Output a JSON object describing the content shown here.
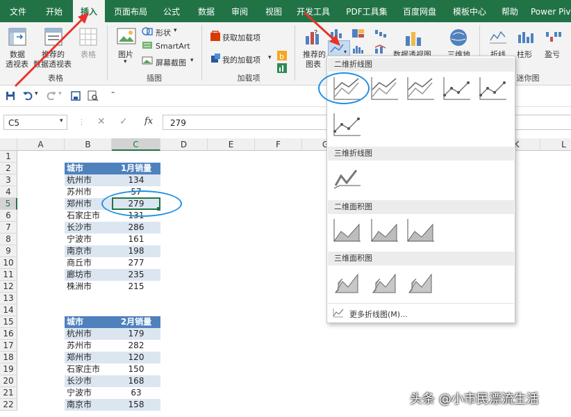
{
  "tabs": [
    "文件",
    "开始",
    "插入",
    "页面布局",
    "公式",
    "数据",
    "审阅",
    "视图",
    "开发工具",
    "PDF工具集",
    "百度网盘",
    "模板中心",
    "帮助",
    "Power Piv"
  ],
  "active_tab": "插入",
  "ribbon": {
    "pivot_label1": "数据",
    "pivot_label2": "透视表",
    "rec_pivot_label1": "推荐的",
    "rec_pivot_label2": "数据透视表",
    "table_label": "表格",
    "group_table": "表格",
    "picture_label": "图片",
    "shapes_label": "形状",
    "smartart_label": "SmartArt",
    "screenshot_label": "屏幕截图",
    "group_illustrations": "插图",
    "get_addins": "获取加载项",
    "my_addins": "我的加载项",
    "group_addins": "加载项",
    "rec_charts1": "推荐的",
    "rec_charts2": "图表",
    "pivot_chart": "数据透视图",
    "map3d": "三维地",
    "spark_line": "折线",
    "spark_column": "柱形",
    "spark_winloss": "盈亏",
    "group_sparklines": "迷你图"
  },
  "namebox": "C5",
  "formula_value": "279",
  "columns": [
    "A",
    "B",
    "C",
    "D",
    "E",
    "F",
    "G",
    "",
    "",
    "",
    "",
    "K",
    "L"
  ],
  "rows": [
    "1",
    "2",
    "3",
    "4",
    "5",
    "6",
    "7",
    "8",
    "9",
    "10",
    "11",
    "12",
    "13",
    "14",
    "15",
    "16",
    "17",
    "18",
    "19",
    "20",
    "21",
    "22"
  ],
  "table1": {
    "header": [
      "城市",
      "1月销量"
    ],
    "rows": [
      [
        "杭州市",
        "134"
      ],
      [
        "苏州市",
        "57"
      ],
      [
        "郑州市",
        "279"
      ],
      [
        "石家庄市",
        "131"
      ],
      [
        "长沙市",
        "286"
      ],
      [
        "宁波市",
        "161"
      ],
      [
        "南京市",
        "198"
      ],
      [
        "商丘市",
        "277"
      ],
      [
        "廊坊市",
        "235"
      ],
      [
        "株洲市",
        "215"
      ]
    ]
  },
  "table2": {
    "header": [
      "城市",
      "2月销量"
    ],
    "rows": [
      [
        "杭州市",
        "179"
      ],
      [
        "苏州市",
        "282"
      ],
      [
        "郑州市",
        "120"
      ],
      [
        "石家庄市",
        "150"
      ],
      [
        "长沙市",
        "168"
      ],
      [
        "宁波市",
        "63"
      ],
      [
        "南京市",
        "158"
      ]
    ]
  },
  "dropdown": {
    "sec_2d_line": "二维折线图",
    "sec_3d_line": "三维折线图",
    "sec_2d_area": "二维面积图",
    "sec_3d_area": "三维面积图",
    "more": "更多折线图(M)..."
  },
  "watermark": "头条 @小市民漂流生活",
  "colors": {
    "excel_green": "#217346",
    "table_header": "#4f81bd",
    "table_band": "#dce6f1",
    "annotation_red": "#e8332a",
    "annotation_blue": "#1e90e6"
  }
}
